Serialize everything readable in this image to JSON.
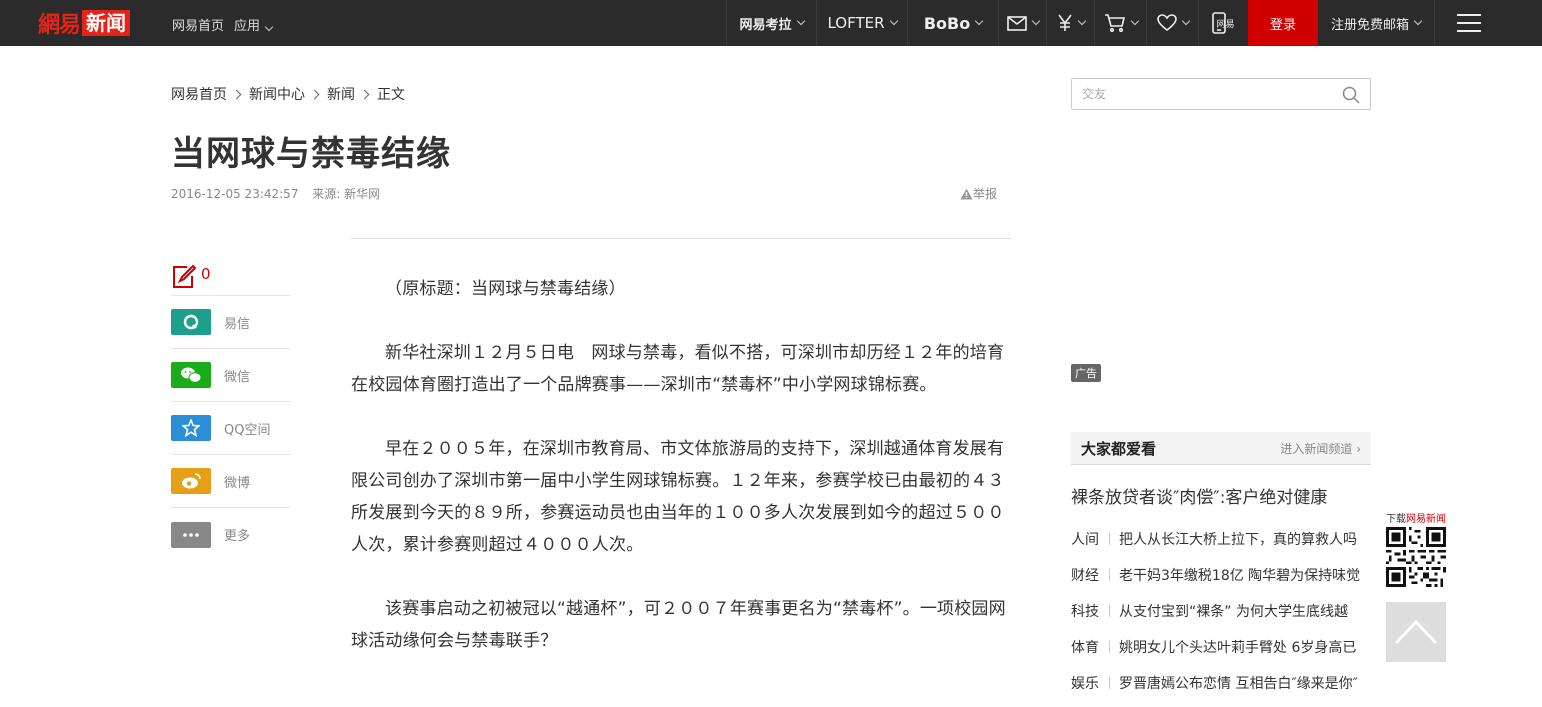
{
  "topbar": {
    "logo_left": "網易",
    "logo_right": "新闻",
    "nav_home": "网易首页",
    "nav_apps": "应用",
    "kaola": "网易考拉",
    "lofter": "LOFTER",
    "bobo": "BoBo",
    "phone_label": "网易",
    "login": "登录",
    "register_mail": "注册免费邮箱"
  },
  "breadcrumb": {
    "items": [
      "网易首页",
      "新闻中心",
      "新闻",
      "正文"
    ]
  },
  "article": {
    "title": "当网球与禁毒结缘",
    "time": "2016-12-05 23:42:57",
    "source": "来源: 新华网",
    "report": "举报",
    "paragraphs": [
      "（原标题：当网球与禁毒结缘）",
      "新华社深圳１２月５日电　网球与禁毒，看似不搭，可深圳市却历经１２年的培育在校园体育圈打造出了一个品牌赛事——深圳市“禁毒杯”中小学网球锦标赛。",
      "早在２００５年，在深圳市教育局、市文体旅游局的支持下，深圳越通体育发展有限公司创办了深圳市第一届中小学生网球锦标赛。１２年来，参赛学校已由最初的４３所发展到今天的８９所，参赛运动员也由当年的１００多人次发展到如今的超过５００人次，累计参赛则超过４０００人次。",
      "该赛事启动之初被冠以“越通杯”，可２００７年赛事更名为“禁毒杯”。一项校园网球活动缘何会与禁毒联手？"
    ]
  },
  "share": {
    "comment_count": "0",
    "items": [
      {
        "label": "易信",
        "color": "#1da08b"
      },
      {
        "label": "微信",
        "color": "#1aad19"
      },
      {
        "label": "QQ空间",
        "color": "#2b8ed6"
      },
      {
        "label": "微博",
        "color": "#e6a017"
      },
      {
        "label": "更多",
        "color": "#888888"
      }
    ]
  },
  "sidebar": {
    "search_placeholder": "交友",
    "ad_label": "广告",
    "popular_title": "大家都爱看",
    "popular_more": "进入新闻频道",
    "headline": "裸条放贷者谈″肉偿″:客户绝对健康",
    "news": [
      {
        "cat": "人间",
        "title": "把人从长江大桥上拉下，真的算救人吗"
      },
      {
        "cat": "财经",
        "title": "老干妈3年缴税18亿  陶华碧为保持味觉"
      },
      {
        "cat": "科技",
        "title": "从支付宝到“裸条”  为何大学生底线越"
      },
      {
        "cat": "体育",
        "title": "姚明女儿个头达叶莉手臂处  6岁身高已"
      },
      {
        "cat": "娱乐",
        "title": "罗晋唐嫣公布恋情  互相告白″缘来是你″"
      }
    ]
  },
  "float": {
    "download_prefix": "下载",
    "download_brand": "网易新闻"
  }
}
